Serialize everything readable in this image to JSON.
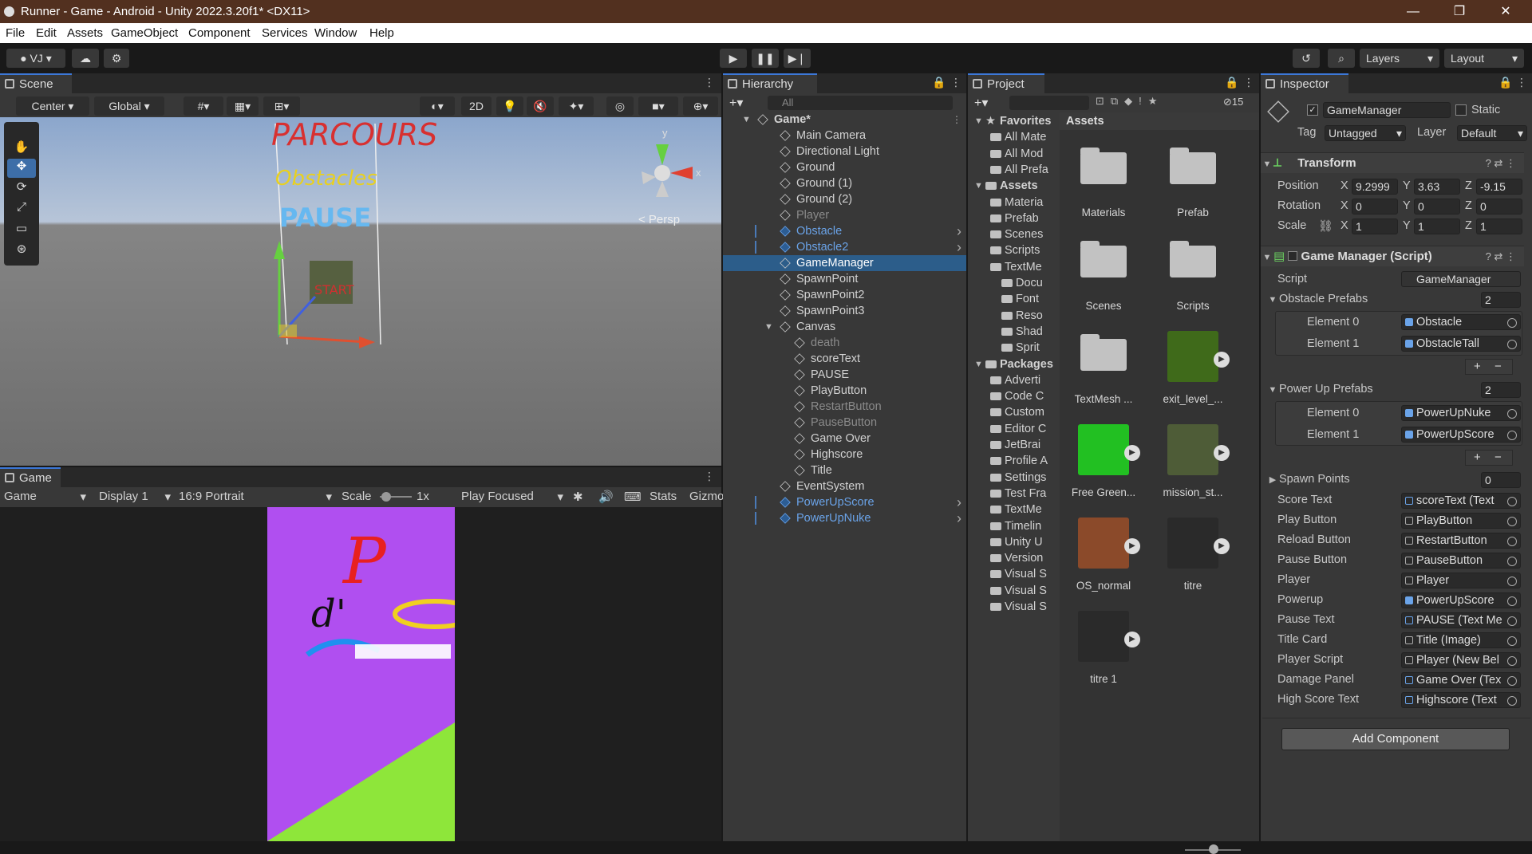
{
  "window": {
    "title": "Runner - Game - Android - Unity 2022.3.20f1* <DX11>",
    "minimize": "—",
    "maximize": "❐",
    "close": "✕"
  },
  "menu": [
    "File",
    "Edit",
    "Assets",
    "GameObject",
    "Component",
    "Services",
    "Window",
    "Help"
  ],
  "toolbar": {
    "account": "VJ",
    "layers": "Layers",
    "layout": "Layout"
  },
  "scene": {
    "tab": "Scene",
    "pivot": "Center",
    "space": "Global",
    "mode2d": "2D",
    "persp": "< Persp",
    "gizmo_y": "y",
    "gizmo_x": "x"
  },
  "game": {
    "tab": "Game",
    "view": "Game",
    "display": "Display 1",
    "aspect": "16:9 Portrait",
    "scale_label": "Scale",
    "scale_value": "1x",
    "play_mode": "Play Focused",
    "stats": "Stats",
    "gizmos": "Gizmo"
  },
  "hierarchy": {
    "tab": "Hierarchy",
    "search_placeholder": "All",
    "items": [
      {
        "label": "Game*",
        "indent": 0,
        "kind": "scene"
      },
      {
        "label": "Main Camera",
        "indent": 1,
        "kind": "normal"
      },
      {
        "label": "Directional Light",
        "indent": 1,
        "kind": "normal"
      },
      {
        "label": "Ground",
        "indent": 1,
        "kind": "normal"
      },
      {
        "label": "Ground (1)",
        "indent": 1,
        "kind": "normal"
      },
      {
        "label": "Ground (2)",
        "indent": 1,
        "kind": "normal"
      },
      {
        "label": "Player",
        "indent": 1,
        "kind": "dim"
      },
      {
        "label": "Obstacle",
        "indent": 1,
        "kind": "prefab"
      },
      {
        "label": "Obstacle2",
        "indent": 1,
        "kind": "prefab"
      },
      {
        "label": "GameManager",
        "indent": 1,
        "kind": "selected"
      },
      {
        "label": "SpawnPoint",
        "indent": 1,
        "kind": "normal"
      },
      {
        "label": "SpawnPoint2",
        "indent": 1,
        "kind": "normal"
      },
      {
        "label": "SpawnPoint3",
        "indent": 1,
        "kind": "normal"
      },
      {
        "label": "Canvas",
        "indent": 1,
        "kind": "expanded"
      },
      {
        "label": "death",
        "indent": 2,
        "kind": "dim"
      },
      {
        "label": "scoreText",
        "indent": 2,
        "kind": "normal"
      },
      {
        "label": "PAUSE",
        "indent": 2,
        "kind": "normal"
      },
      {
        "label": "PlayButton",
        "indent": 2,
        "kind": "normal"
      },
      {
        "label": "RestartButton",
        "indent": 2,
        "kind": "dim"
      },
      {
        "label": "PauseButton",
        "indent": 2,
        "kind": "dim"
      },
      {
        "label": "Game Over",
        "indent": 2,
        "kind": "normal"
      },
      {
        "label": "Highscore",
        "indent": 2,
        "kind": "normal"
      },
      {
        "label": "Title",
        "indent": 2,
        "kind": "normal"
      },
      {
        "label": "EventSystem",
        "indent": 1,
        "kind": "normal"
      },
      {
        "label": "PowerUpScore",
        "indent": 1,
        "kind": "prefab"
      },
      {
        "label": "PowerUpNuke",
        "indent": 1,
        "kind": "prefab"
      }
    ]
  },
  "project": {
    "tab": "Project",
    "count": "15",
    "breadcrumb": "Assets",
    "tree": [
      {
        "label": "Favorites",
        "indent": 0,
        "bold": true
      },
      {
        "label": "All Mate",
        "indent": 1
      },
      {
        "label": "All Mod",
        "indent": 1
      },
      {
        "label": "All Prefa",
        "indent": 1
      },
      {
        "label": "Assets",
        "indent": 0,
        "bold": true
      },
      {
        "label": "Materia",
        "indent": 1
      },
      {
        "label": "Prefab",
        "indent": 1
      },
      {
        "label": "Scenes",
        "indent": 1
      },
      {
        "label": "Scripts",
        "indent": 1
      },
      {
        "label": "TextMe",
        "indent": 1
      },
      {
        "label": "Docu",
        "indent": 2
      },
      {
        "label": "Font",
        "indent": 2
      },
      {
        "label": "Reso",
        "indent": 2
      },
      {
        "label": "Shad",
        "indent": 2
      },
      {
        "label": "Sprit",
        "indent": 2
      },
      {
        "label": "Packages",
        "indent": 0,
        "bold": true
      },
      {
        "label": "Adverti",
        "indent": 1
      },
      {
        "label": "Code C",
        "indent": 1
      },
      {
        "label": "Custom",
        "indent": 1
      },
      {
        "label": "Editor C",
        "indent": 1
      },
      {
        "label": "JetBrai",
        "indent": 1
      },
      {
        "label": "Profile A",
        "indent": 1
      },
      {
        "label": "Settings",
        "indent": 1
      },
      {
        "label": "Test Fra",
        "indent": 1
      },
      {
        "label": "TextMe",
        "indent": 1
      },
      {
        "label": "Timelin",
        "indent": 1
      },
      {
        "label": "Unity U",
        "indent": 1
      },
      {
        "label": "Version",
        "indent": 1
      },
      {
        "label": "Visual S",
        "indent": 1
      },
      {
        "label": "Visual S",
        "indent": 1
      },
      {
        "label": "Visual S",
        "indent": 1
      }
    ],
    "assets": [
      {
        "label": "Materials",
        "type": "folder"
      },
      {
        "label": "Prefab",
        "type": "folder"
      },
      {
        "label": "Scenes",
        "type": "folder"
      },
      {
        "label": "Scripts",
        "type": "folder"
      },
      {
        "label": "TextMesh ...",
        "type": "folder"
      },
      {
        "label": "exit_level_...",
        "type": "image",
        "color": "#3f6a1a"
      },
      {
        "label": "Free Green...",
        "type": "image",
        "color": "#22c022"
      },
      {
        "label": "mission_st...",
        "type": "image",
        "color": "#4e5c37"
      },
      {
        "label": "OS_normal",
        "type": "image",
        "color": "#8b4a2a"
      },
      {
        "label": "titre",
        "type": "image",
        "color": "#2a2a2a"
      },
      {
        "label": "titre 1",
        "type": "image",
        "color": "#2a2a2a"
      }
    ]
  },
  "inspector": {
    "tab": "Inspector",
    "object_name": "GameManager",
    "static": "Static",
    "tag_label": "Tag",
    "tag": "Untagged",
    "layer_label": "Layer",
    "layer": "Default",
    "transform": {
      "title": "Transform",
      "position_label": "Position",
      "rotation_label": "Rotation",
      "scale_label": "Scale",
      "position": [
        "9.2999",
        "3.63",
        "-9.15"
      ],
      "rotation": [
        "0",
        "0",
        "0"
      ],
      "scale": [
        "1",
        "1",
        "1"
      ],
      "axes": [
        "X",
        "Y",
        "Z"
      ]
    },
    "script": {
      "title": "Game Manager (Script)",
      "script_label": "Script",
      "script_value": "GameManager",
      "obstacle_prefabs": {
        "label": "Obstacle Prefabs",
        "count": "2",
        "elements": [
          {
            "label": "Element 0",
            "value": "Obstacle"
          },
          {
            "label": "Element 1",
            "value": "ObstacleTall"
          }
        ]
      },
      "powerup_prefabs": {
        "label": "Power Up Prefabs",
        "count": "2",
        "elements": [
          {
            "label": "Element 0",
            "value": "PowerUpNuke"
          },
          {
            "label": "Element 1",
            "value": "PowerUpScore"
          }
        ]
      },
      "spawn_points": {
        "label": "Spawn Points",
        "count": "0"
      },
      "fields": [
        {
          "label": "Score Text",
          "value": "scoreText (Text"
        },
        {
          "label": "Play Button",
          "value": "PlayButton"
        },
        {
          "label": "Reload Button",
          "value": "RestartButton"
        },
        {
          "label": "Pause Button",
          "value": "PauseButton"
        },
        {
          "label": "Player",
          "value": "Player"
        },
        {
          "label": "Powerup",
          "value": "PowerUpScore"
        },
        {
          "label": "Pause Text",
          "value": "PAUSE (Text Me"
        },
        {
          "label": "Title Card",
          "value": "Title (Image)"
        },
        {
          "label": "Player Script",
          "value": "Player (New Bel"
        },
        {
          "label": "Damage Panel",
          "value": "Game Over (Tex"
        },
        {
          "label": "High Score Text",
          "value": "Highscore (Text"
        }
      ],
      "plus": "+",
      "minus": "−"
    },
    "add_component": "Add Component"
  }
}
